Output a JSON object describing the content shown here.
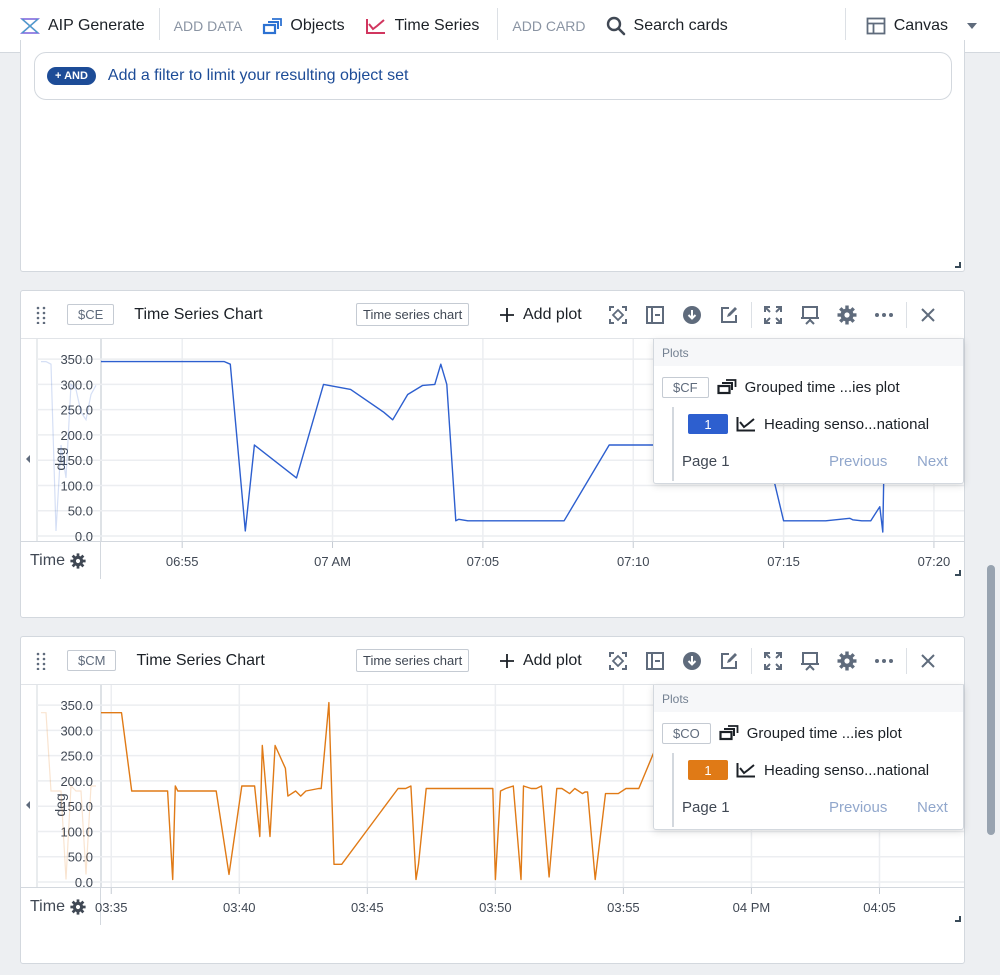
{
  "toolbar": {
    "aip_label": "AIP Generate",
    "add_data_label": "ADD DATA",
    "objects_label": "Objects",
    "time_series_label": "Time Series",
    "add_card_label": "ADD CARD",
    "search_cards_label": "Search cards",
    "canvas_label": "Canvas",
    "colors": {
      "aip": "#7961db",
      "objects": "#2d72d2",
      "time_series": "#d1365f"
    }
  },
  "filter_card": {
    "and_button_label": "+ AND",
    "filter_prompt": "Add a filter to limit your resulting object set"
  },
  "cards": [
    {
      "rid": "$CE",
      "title": "Time Series Chart",
      "type_tag": "Time series chart",
      "add_plot_label": "Add plot",
      "time_label": "Time",
      "plots_panel": {
        "header": "Plots",
        "group_rid": "$CF",
        "group_label": "Grouped time ...ies plot",
        "series_number": "1",
        "series_label": "Heading senso...national",
        "page_label": "Page 1",
        "previous_label": "Previous",
        "next_label": "Next"
      }
    },
    {
      "rid": "$CM",
      "title": "Time Series Chart",
      "type_tag": "Time series chart",
      "add_plot_label": "Add plot",
      "time_label": "Time",
      "plots_panel": {
        "header": "Plots",
        "group_rid": "$CO",
        "group_label": "Grouped time ...ies plot",
        "series_number": "1",
        "series_label": "Heading senso...national",
        "page_label": "Page 1",
        "previous_label": "Previous",
        "next_label": "Next"
      }
    }
  ],
  "chart_data": [
    {
      "type": "line",
      "title": "Time Series Chart",
      "xlabel": "Time",
      "ylabel": "deg",
      "ylim": [
        0,
        370
      ],
      "yticks": [
        "0.0",
        "50.0",
        "100.0",
        "150.0",
        "200.0",
        "250.0",
        "300.0",
        "350.0"
      ],
      "xticks": [
        "06:55",
        "07 AM",
        "07:05",
        "07:10",
        "07:15",
        "07:20"
      ],
      "xlim_minutes": [
        52.3,
        81.0
      ],
      "grid": true,
      "legend": "top-right",
      "series": [
        {
          "name": "Heading senso...national",
          "color": "#2d5fcf",
          "x_minutes": [
            52.3,
            56.4,
            56.6,
            57.1,
            57.4,
            58.8,
            59.7,
            60.6,
            61.7,
            62.0,
            62.5,
            63.0,
            63.4,
            63.6,
            63.8,
            64.1,
            64.2,
            64.3,
            64.5,
            65.0,
            67.7,
            69.2,
            74.4,
            75.0,
            75.2,
            76.4,
            77.2,
            77.3,
            77.6,
            77.9,
            78.2,
            78.3,
            78.4,
            81.0
          ],
          "values": [
            345,
            345,
            340,
            10,
            180,
            115,
            300,
            290,
            245,
            230,
            280,
            298,
            300,
            340,
            300,
            30,
            33,
            32,
            30,
            30,
            30,
            180,
            180,
            30,
            30,
            30,
            35,
            32,
            30,
            30,
            58,
            8,
            345,
            345
          ]
        }
      ]
    },
    {
      "type": "line",
      "title": "Time Series Chart",
      "xlabel": "Time",
      "ylabel": "deg",
      "ylim": [
        0,
        370
      ],
      "yticks": [
        "0.0",
        "50.0",
        "100.0",
        "150.0",
        "200.0",
        "250.0",
        "300.0",
        "350.0"
      ],
      "xticks": [
        "03:35",
        "03:40",
        "03:45",
        "03:50",
        "03:55",
        "04 PM",
        "04:05"
      ],
      "xlim_minutes": [
        34.6,
        68.3
      ],
      "grid": true,
      "legend": "top-right",
      "series": [
        {
          "name": "Heading senso...national",
          "color": "#e07a16",
          "x_minutes": [
            34.6,
            35.4,
            35.8,
            37.0,
            37.2,
            37.4,
            37.5,
            37.6,
            39.1,
            39.6,
            40.1,
            40.5,
            40.6,
            40.8,
            40.9,
            41.2,
            41.4,
            41.8,
            41.9,
            42.2,
            42.4,
            42.6,
            43.1,
            43.2,
            43.5,
            43.7,
            44.0,
            46.2,
            46.3,
            46.5,
            46.7,
            46.9,
            47.0,
            47.3,
            49.3,
            49.9,
            50.0,
            50.2,
            50.4,
            50.7,
            51.0,
            51.1,
            51.4,
            51.6,
            51.8,
            52.1,
            52.4,
            52.6,
            52.9,
            53.1,
            53.4,
            53.5,
            53.6,
            53.9,
            54.3,
            54.4,
            54.8,
            55.1,
            55.6,
            56.3,
            56.5,
            56.9,
            58.2,
            59.5,
            60.1,
            61.0,
            63.3,
            64.9,
            65.2,
            66.0,
            68.3
          ],
          "values": [
            335,
            335,
            180,
            180,
            180,
            5,
            190,
            180,
            180,
            15,
            190,
            190,
            190,
            90,
            270,
            90,
            270,
            225,
            170,
            180,
            170,
            180,
            185,
            185,
            355,
            35,
            35,
            185,
            185,
            185,
            190,
            5,
            35,
            185,
            185,
            185,
            5,
            180,
            185,
            190,
            5,
            190,
            185,
            185,
            190,
            10,
            185,
            185,
            175,
            185,
            175,
            178,
            178,
            5,
            175,
            175,
            175,
            185,
            185,
            270,
            300,
            270,
            270,
            270,
            185,
            185,
            185,
            185,
            185,
            185,
            215
          ]
        }
      ]
    }
  ]
}
